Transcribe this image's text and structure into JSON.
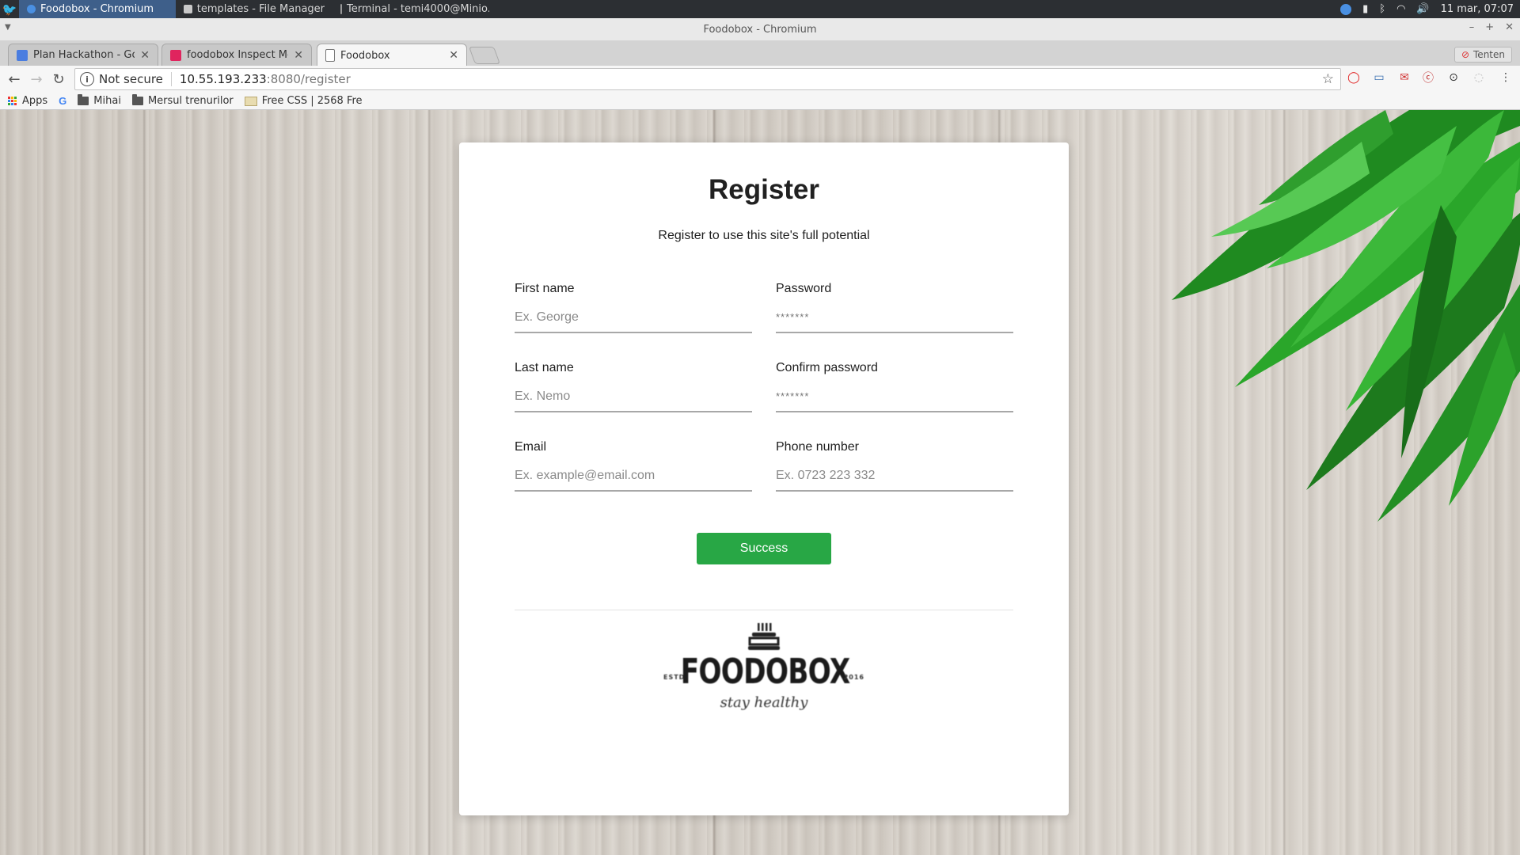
{
  "taskbar": {
    "tasks": [
      {
        "label": "Foodobox - Chromium"
      },
      {
        "label": "templates - File Manager"
      },
      {
        "label": "Terminal - temi4000@Minio..."
      }
    ],
    "clock": "11 mar, 07:07"
  },
  "window": {
    "title": "Foodobox - Chromium"
  },
  "tabs": [
    {
      "label": "Plan Hackathon - Goog",
      "favicon_color": "#4a7de0"
    },
    {
      "label": "foodobox Inspect Mode",
      "favicon_color": "#e0245e"
    },
    {
      "label": "Foodobox",
      "favicon_color": "#ffffff"
    }
  ],
  "profile": {
    "label": "Tenten"
  },
  "omnibox": {
    "security": "Not secure",
    "host": "10.55.193.233",
    "path": ":8080/register"
  },
  "bookmarks": [
    {
      "label": "Apps"
    },
    {
      "label": "Mihai"
    },
    {
      "label": "Mersul trenurilor"
    },
    {
      "label": "Free CSS | 2568 Fre"
    }
  ],
  "page": {
    "title": "Register",
    "subtitle": "Register to use this site's full potential",
    "fields": {
      "first_name": {
        "label": "First name",
        "placeholder": "Ex. George"
      },
      "password": {
        "label": "Password",
        "placeholder": "*******"
      },
      "last_name": {
        "label": "Last name",
        "placeholder": "Ex. Nemo"
      },
      "confirm_password": {
        "label": "Confirm password",
        "placeholder": "*******"
      },
      "email": {
        "label": "Email",
        "placeholder": "Ex. example@email.com"
      },
      "phone": {
        "label": "Phone number",
        "placeholder": "Ex. 0723 223 332"
      }
    },
    "submit_label": "Success",
    "logo": {
      "brand": "FOODOBOX",
      "estd": "ESTD",
      "year": "2016",
      "tagline": "stay healthy"
    }
  },
  "colors": {
    "accent_green": "#28a745",
    "taskbar_bg": "#2c2f33"
  }
}
